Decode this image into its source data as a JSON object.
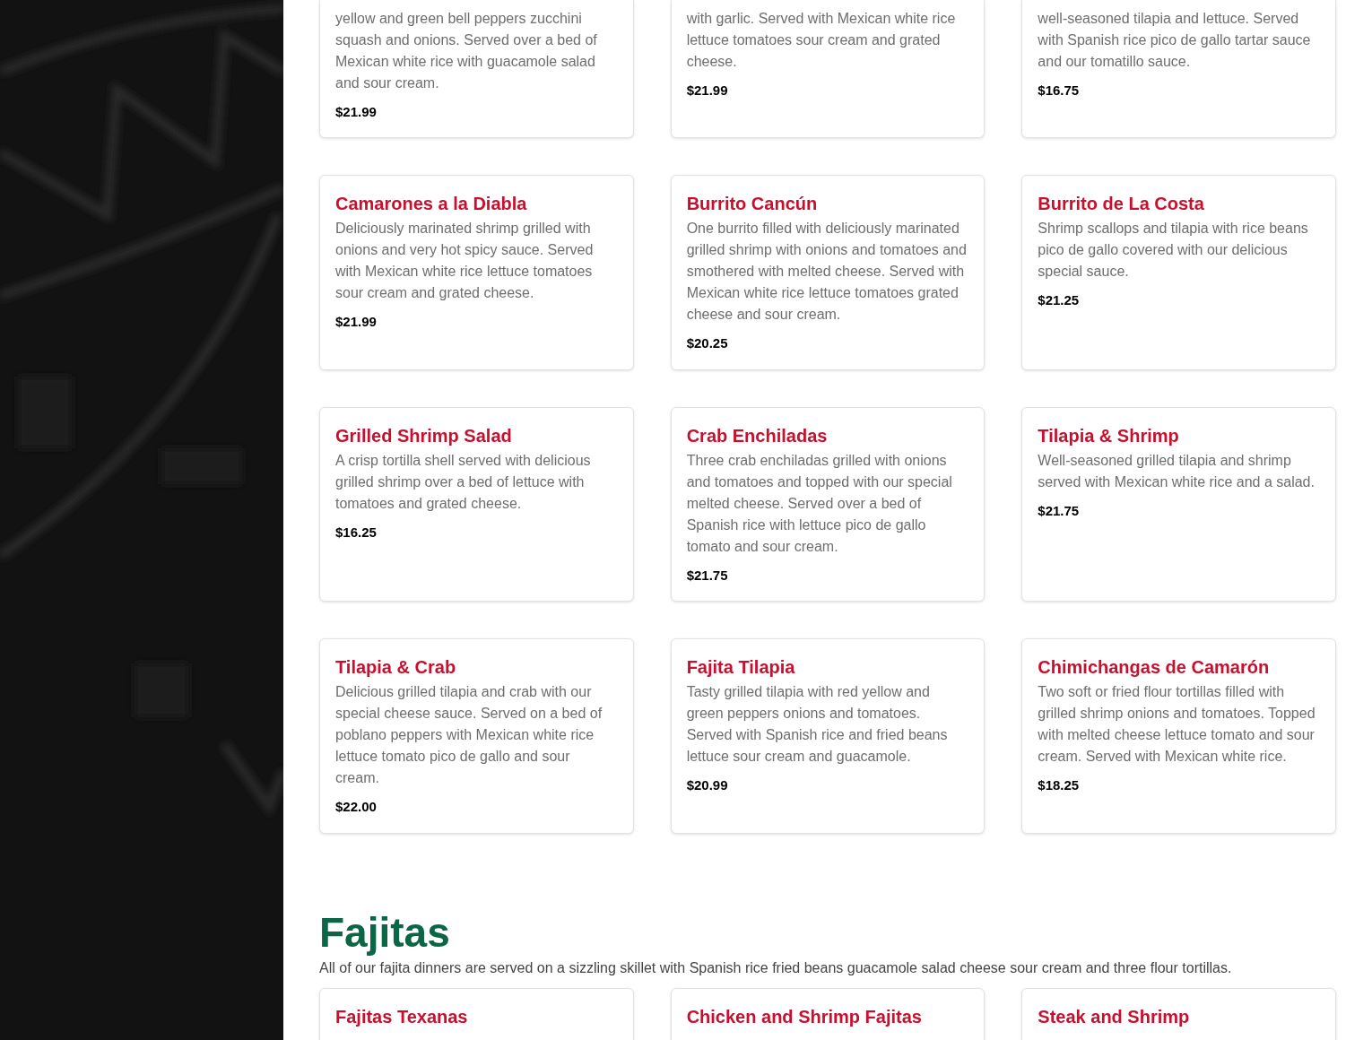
{
  "sections": [
    {
      "partial_items": [
        {
          "description": "yellow and green bell peppers zucchini squash and onions. Served over a bed of Mexican white rice with guacamole salad and sour cream.",
          "price": "$21.99"
        },
        {
          "description": "with garlic. Served with Mexican white rice lettuce tomatoes sour cream and grated cheese.",
          "price": "$21.99"
        },
        {
          "description": "well-seasoned tilapia and lettuce. Served with Spanish rice pico de gallo tartar sauce and our tomatillo sauce.",
          "price": "$16.75"
        }
      ],
      "items": [
        {
          "name": "Camarones a la Diabla",
          "description": "Deliciously marinated shrimp grilled with onions and very hot spicy sauce. Served with Mexican white rice lettuce tomatoes sour cream and grated cheese.",
          "price": "$21.99"
        },
        {
          "name": "Burrito Cancún",
          "description": "One burrito filled with deliciously marinated grilled shrimp with onions and tomatoes and smothered with melted cheese. Served with Mexican white rice lettuce tomatoes grated cheese and sour cream.",
          "price": "$20.25"
        },
        {
          "name": "Burrito de La Costa",
          "description": "Shrimp scallops and tilapia with rice beans pico de gallo covered with our delicious special sauce.",
          "price": "$21.25"
        },
        {
          "name": "Grilled Shrimp Salad",
          "description": "A crisp tortilla shell served with delicious grilled shrimp over a bed of lettuce with tomatoes and grated cheese.",
          "price": "$16.25"
        },
        {
          "name": "Crab Enchiladas",
          "description": "Three crab enchiladas grilled with onions and tomatoes and topped with our special melted cheese. Served over a bed of Spanish rice with lettuce pico de gallo tomato and sour cream.",
          "price": "$21.75"
        },
        {
          "name": "Tilapia & Shrimp",
          "description": "Well-seasoned grilled tilapia and shrimp served with Mexican white rice and a salad.",
          "price": "$21.75"
        },
        {
          "name": "Tilapia & Crab",
          "description": "Delicious grilled tilapia and crab with our special cheese sauce. Served on a bed of poblano peppers with Mexican white rice lettuce tomato pico de gallo and sour cream.",
          "price": "$22.00"
        },
        {
          "name": "Fajita Tilapia",
          "description": "Tasty grilled tilapia with red yellow and green peppers onions and tomatoes. Served with Spanish rice and fried beans lettuce sour cream and guacamole.",
          "price": "$20.99"
        },
        {
          "name": "Chimichangas de Camarón",
          "description": "Two soft or fried flour tortillas filled with grilled shrimp onions and tomatoes. Topped with melted cheese lettuce tomato and sour cream. Served with Mexican white rice.",
          "price": "$18.25"
        }
      ]
    },
    {
      "title": "Fajitas",
      "description": "All of our fajita dinners are served on a sizzling skillet with Spanish rice fried beans guacamole salad cheese sour cream and three flour tortillas.",
      "items": [
        {
          "name": "Fajitas Texanas"
        },
        {
          "name": "Chicken and Shrimp Fajitas"
        },
        {
          "name": "Steak and Shrimp"
        }
      ]
    }
  ]
}
